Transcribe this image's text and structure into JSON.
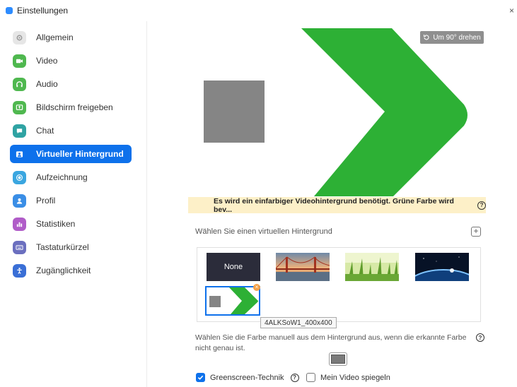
{
  "window": {
    "title": "Einstellungen",
    "close_glyph": "×"
  },
  "colors": {
    "accent": "#0e71eb",
    "green_screen": "#2db035",
    "warning_bg": "#fdf0c8"
  },
  "sidebar": {
    "items": [
      {
        "label": "Allgemein",
        "icon": "gear-icon",
        "color": "#e8e8e8",
        "active": false
      },
      {
        "label": "Video",
        "icon": "video-camera-icon",
        "color": "#5cb85c",
        "active": false
      },
      {
        "label": "Audio",
        "icon": "headphones-icon",
        "color": "#5cb85c",
        "active": false
      },
      {
        "label": "Bildschirm freigeben",
        "icon": "share-screen-icon",
        "color": "#5cb85c",
        "active": false
      },
      {
        "label": "Chat",
        "icon": "chat-bubble-icon",
        "color": "#33a8a8",
        "active": false
      },
      {
        "label": "Virtueller Hintergrund",
        "icon": "person-card-icon",
        "color": "#0e71eb",
        "active": true
      },
      {
        "label": "Aufzeichnung",
        "icon": "record-icon",
        "color": "#3aa6e0",
        "active": false
      },
      {
        "label": "Profil",
        "icon": "user-icon",
        "color": "#3a8ee6",
        "active": false
      },
      {
        "label": "Statistiken",
        "icon": "bar-chart-icon",
        "color": "#b05cc8",
        "active": false
      },
      {
        "label": "Tastaturkürzel",
        "icon": "keyboard-icon",
        "color": "#6b6fbf",
        "active": false
      },
      {
        "label": "Zugänglichkeit",
        "icon": "accessibility-icon",
        "color": "#3a6fd6",
        "active": false
      }
    ]
  },
  "preview": {
    "rotate_label": "Um 90° drehen",
    "warning": "Es wird ein einfarbiger Videohintergrund benötigt. Grüne Farbe wird bev..."
  },
  "background": {
    "section_label": "Wählen Sie einen virtuellen Hintergrund",
    "add_glyph": "+",
    "thumbs": [
      {
        "label": "None",
        "kind": "none"
      },
      {
        "label": "",
        "kind": "golden-gate-bridge"
      },
      {
        "label": "",
        "kind": "grass"
      },
      {
        "label": "",
        "kind": "earth-from-space"
      },
      {
        "label": "",
        "kind": "custom-green-arrow"
      }
    ],
    "selected_tooltip": "4ALKSoW1_400x400",
    "delete_glyph": "×"
  },
  "manual_color": {
    "text": "Wählen Sie die Farbe manuell aus dem Hintergrund aus, wenn die erkannte Farbe nicht genau ist.",
    "swatch_color": "#7a7a7a"
  },
  "options": {
    "greenscreen_label": "Greenscreen-Technik",
    "greenscreen_checked": true,
    "mirror_label": "Mein Video spiegeln",
    "mirror_checked": false
  },
  "help_glyph": "?"
}
